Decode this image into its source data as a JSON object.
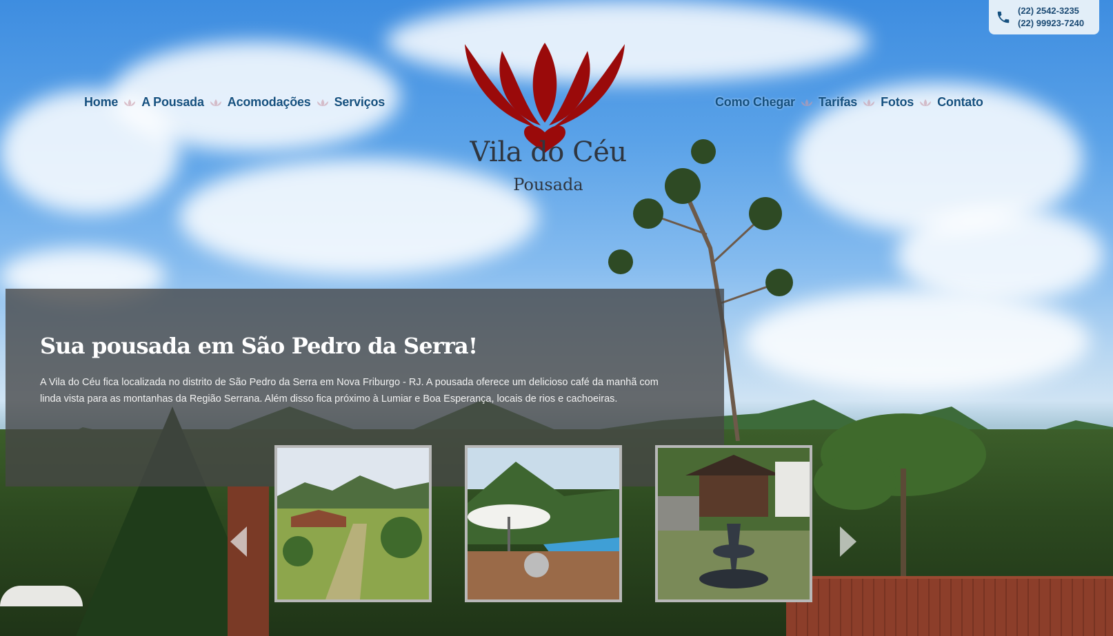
{
  "contact": {
    "phone_icon": "phone-icon",
    "phone_1": "(22) 2542-3235",
    "phone_2": "(22) 99923-7240"
  },
  "nav_left": [
    {
      "label": "Home"
    },
    {
      "label": "A Pousada"
    },
    {
      "label": "Acomodações"
    },
    {
      "label": "Serviços"
    }
  ],
  "nav_right": [
    {
      "label": "Como Chegar"
    },
    {
      "label": "Tarifas"
    },
    {
      "label": "Fotos"
    },
    {
      "label": "Contato"
    }
  ],
  "logo": {
    "title": "Vila do Céu",
    "subtitle": "Pousada",
    "icon": "lotus-logo-icon",
    "color": "#9a0a0a"
  },
  "intro": {
    "heading": "Sua pousada em São Pedro da Serra!",
    "text": "A Vila do Céu fica localizada no distrito de São Pedro da Serra em Nova Friburgo - RJ. A pousada oferece um delicioso café da manhã com linda vista para as montanhas da Região Serrana. Além disso fica próximo à Lumiar e Boa Esperança, locais de rios e cachoeiras."
  },
  "carousel": {
    "prev_icon": "chevron-left-icon",
    "next_icon": "chevron-right-icon"
  },
  "colors": {
    "nav_text": "#15507f",
    "separator": "#c99aa8"
  }
}
